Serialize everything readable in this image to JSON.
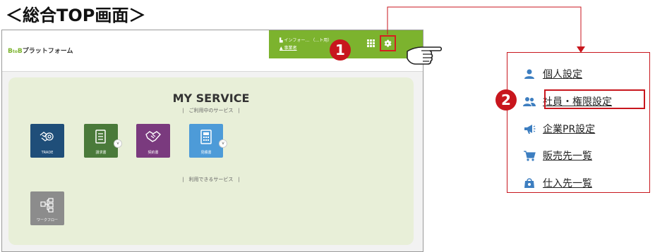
{
  "page": {
    "title": "＜総合TOP画面＞"
  },
  "header": {
    "logo_prefix": "B",
    "logo_to": "to",
    "logo_suffix": "B",
    "logo_name": "プラットフォーム",
    "user_company": "インフォー… （…ト用）",
    "user_name": "事業者",
    "accent_color": "#7cb32e"
  },
  "main": {
    "title": "MY SERVICE",
    "subtitle_used": "|　ご利用中のサービス　|",
    "subtitle_available": "|　利用できるサービス　|",
    "services_used": [
      {
        "label": "TRADE",
        "icon": "handshake-gear-icon",
        "color": "#1f4e79"
      },
      {
        "label": "請求書",
        "icon": "document-icon",
        "color": "#4a7a3a"
      },
      {
        "label": "契約書",
        "icon": "handshake-icon",
        "color": "#7a3a7e"
      },
      {
        "label": "見積書",
        "icon": "calculator-icon",
        "color": "#4d9bd8"
      }
    ],
    "services_available": [
      {
        "label": "ワークフロー",
        "icon": "workflow-icon",
        "color": "#8c8c8c"
      }
    ]
  },
  "callouts": {
    "step1": "1",
    "step2": "2"
  },
  "menu": {
    "items": [
      {
        "label": "個人設定",
        "icon": "person-icon"
      },
      {
        "label": "社員・権限設定",
        "icon": "people-icon"
      },
      {
        "label": "企業PR設定",
        "icon": "megaphone-icon"
      },
      {
        "label": "販売先一覧",
        "icon": "cart-icon"
      },
      {
        "label": "仕入先一覧",
        "icon": "bag-icon"
      }
    ],
    "icon_color": "#3d7ec0"
  }
}
